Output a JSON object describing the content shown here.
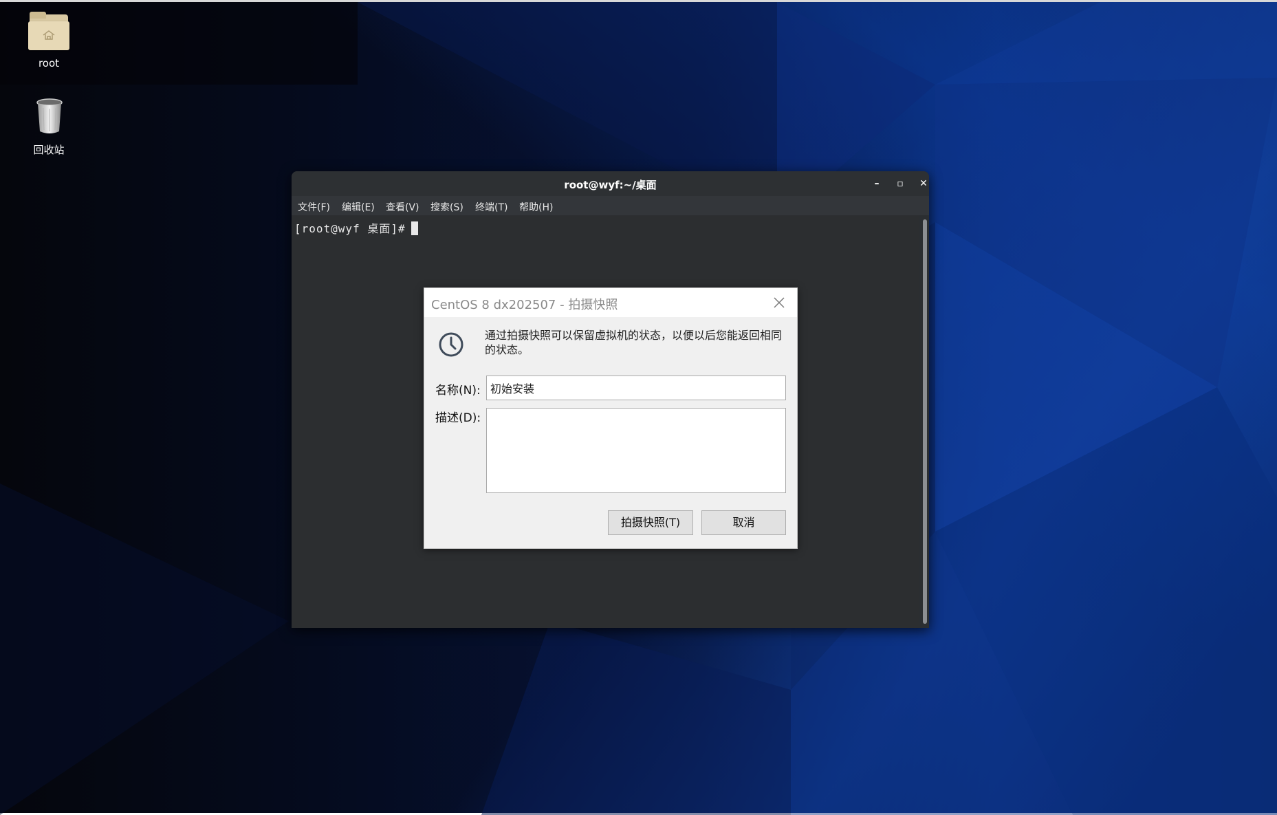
{
  "desktop": {
    "icons": [
      {
        "label": "root",
        "icon": "home-folder-icon"
      },
      {
        "label": "回收站",
        "icon": "trash-icon"
      }
    ]
  },
  "terminal": {
    "title": "root@wyf:~/桌面",
    "window_controls": {
      "minimize": "–",
      "maximize": "▫",
      "close": "✕"
    },
    "menu": [
      "文件(F)",
      "编辑(E)",
      "查看(V)",
      "搜索(S)",
      "终端(T)",
      "帮助(H)"
    ],
    "prompt": "[root@wyf 桌面]#"
  },
  "dialog": {
    "title": "CentOS 8 dx202507 - 拍摄快照",
    "icon": "clock-icon",
    "description": "通过拍摄快照可以保留虚拟机的状态，以便以后您能返回相同的状态。",
    "name_label": "名称(N):",
    "name_value": "初始安装",
    "desc_label": "描述(D):",
    "desc_value": "",
    "take_snapshot_button": "拍摄快照(T)",
    "cancel_button": "取消"
  },
  "colors": {
    "terminal_bg": "#2c2e30",
    "dialog_bg": "#f0f0f0",
    "desktop_accent": "#0b2e7a"
  }
}
